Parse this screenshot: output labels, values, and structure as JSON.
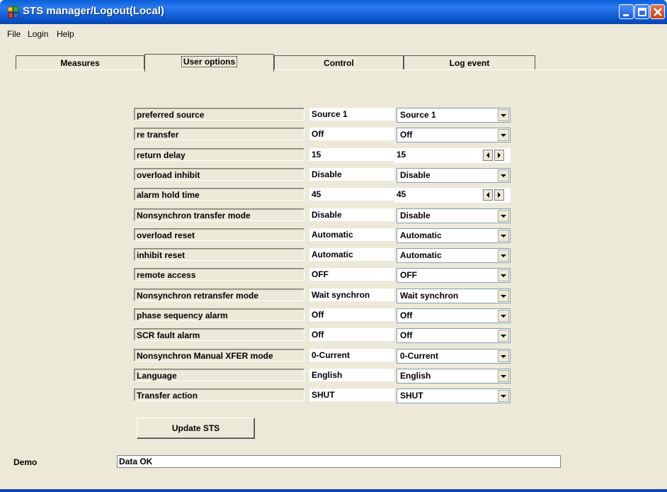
{
  "window": {
    "title": "STS manager/Logout(Local)",
    "icon": "app-icon"
  },
  "menu": [
    "File",
    "Login",
    "Help"
  ],
  "tabs": [
    {
      "label": "Measures",
      "active": false
    },
    {
      "label": "User options",
      "active": true
    },
    {
      "label": "Control",
      "active": false
    },
    {
      "label": "Log event",
      "active": false
    }
  ],
  "options": [
    {
      "label": "preferred source",
      "current": "Source 1",
      "setting": "Source 1",
      "control": "dropdown"
    },
    {
      "label": "re transfer",
      "current": "Off",
      "setting": "Off",
      "control": "dropdown"
    },
    {
      "label": "return delay",
      "current": "15",
      "setting": "15",
      "control": "spinner"
    },
    {
      "label": "overload inhibit",
      "current": "Disable",
      "setting": "Disable",
      "control": "dropdown"
    },
    {
      "label": "alarm hold time",
      "current": "45",
      "setting": "45",
      "control": "spinner"
    },
    {
      "label": "Nonsynchron transfer mode",
      "current": "Disable",
      "setting": "Disable",
      "control": "dropdown"
    },
    {
      "label": "overload reset",
      "current": "Automatic",
      "setting": "Automatic",
      "control": "dropdown"
    },
    {
      "label": "inhibit reset",
      "current": "Automatic",
      "setting": "Automatic",
      "control": "dropdown"
    },
    {
      "label": "remote access",
      "current": "OFF",
      "setting": "OFF",
      "control": "dropdown"
    },
    {
      "label": "Nonsynchron retransfer mode",
      "current": "Wait synchron",
      "setting": "Wait synchron",
      "control": "dropdown"
    },
    {
      "label": "phase sequency alarm",
      "current": "Off",
      "setting": "Off",
      "control": "dropdown"
    },
    {
      "label": "SCR fault alarm",
      "current": "Off",
      "setting": "Off",
      "control": "dropdown"
    },
    {
      "label": "Nonsynchron Manual XFER mode",
      "current": "0-Current",
      "setting": "0-Current",
      "control": "dropdown"
    },
    {
      "label": "Language",
      "current": "English",
      "setting": "English",
      "control": "dropdown"
    },
    {
      "label": "Transfer action",
      "current": "SHUT",
      "setting": "SHUT",
      "control": "dropdown"
    }
  ],
  "update_button": "Update STS",
  "status": {
    "label": "Demo",
    "message": "Data OK"
  },
  "colors": {
    "titlebar": "#0a5fd8",
    "face": "#ece9d8",
    "close": "#c4401c"
  }
}
